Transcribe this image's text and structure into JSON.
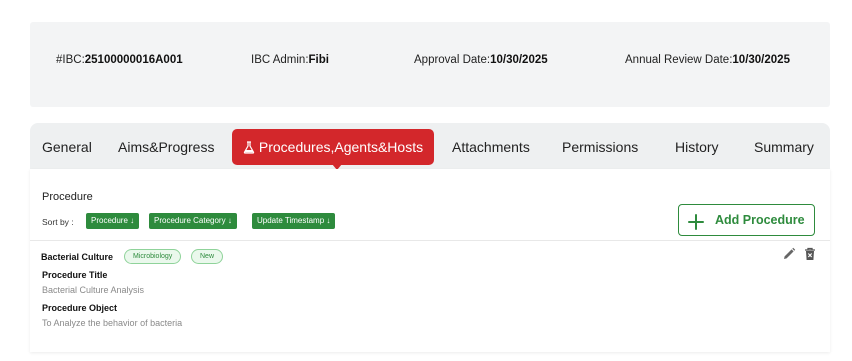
{
  "info": {
    "ibc_label": "#IBC:",
    "ibc_value": "25100000016A001",
    "admin_label": "IBC Admin:",
    "admin_value": "Fibi",
    "approval_label": "Approval Date:",
    "approval_value": "10/30/2025",
    "review_label": "Annual Review Date:",
    "review_value": "10/30/2025"
  },
  "tabs": {
    "general": "General",
    "aims": "Aims&Progress",
    "procedures": "Procedures,Agents&Hosts",
    "attachments": "Attachments",
    "permissions": "Permissions",
    "history": "History",
    "summary": "Summary"
  },
  "section": {
    "heading": "Procedure",
    "sort_by": "Sort by :",
    "sort_chips": [
      "Procedure ↓",
      "Procedure Category ↓",
      "Update Timestamp ↓"
    ],
    "add_button": "Add Procedure"
  },
  "procedure": {
    "name": "Bacterial Culture",
    "tags": [
      "Microbiology",
      "New"
    ],
    "title_label": "Procedure Title",
    "title_value": "Bacterial Culture Analysis",
    "object_label": "Procedure Object",
    "object_value": "To Analyze the behavior of bacteria"
  },
  "colors": {
    "accent_red": "#d3272b",
    "accent_green": "#2e8b3d"
  },
  "icons": [
    "flask-icon",
    "plus-icon",
    "edit-icon",
    "delete-icon"
  ]
}
